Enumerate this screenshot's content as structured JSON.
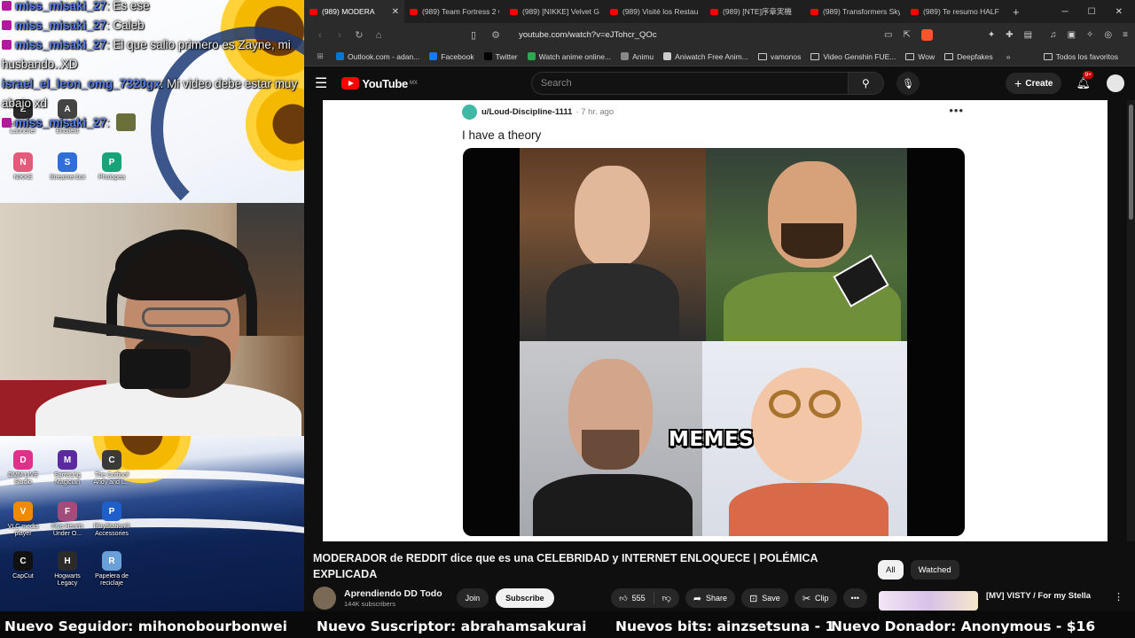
{
  "chat": {
    "lines": [
      {
        "user": "miss_misaki_27",
        "message": "Es ese"
      },
      {
        "user": "miss_misaki_27",
        "message": "Caleb"
      },
      {
        "user": "miss_misaki_27",
        "message": "El que salio primero es Zayne, mi husbando..XD"
      },
      {
        "user": "israel_el_leon_omg_7320gx",
        "message": "Mi video debe estar muy abajo xd"
      },
      {
        "user": "miss_misaki_27",
        "message": ""
      }
    ]
  },
  "desktop_icons": [
    {
      "label": "Epic Games Launcher",
      "color": "#2a2a2a",
      "glyph": "E"
    },
    {
      "label": "Arknights Endfield",
      "color": "#444444",
      "glyph": "A"
    },
    {
      "label": "NIKKE",
      "color": "#e35a7a",
      "glyph": "N"
    },
    {
      "label": "Streamer.bot",
      "color": "#2f6fd6",
      "glyph": "S"
    },
    {
      "label": "Photopea",
      "color": "#18a37a",
      "glyph": "P"
    },
    {
      "label": "DMM LIVE Studio",
      "color": "#e0318a",
      "glyph": "D"
    },
    {
      "label": "Samsung Magician",
      "color": "#5b2aa0",
      "glyph": "M"
    },
    {
      "label": "The Coffinof Andy and L...",
      "color": "#3a3a3a",
      "glyph": "C"
    },
    {
      "label": "VLC media player",
      "color": "#f08a00",
      "glyph": "V"
    },
    {
      "label": "Five Hearts Under O...",
      "color": "#a34b7a",
      "glyph": "F"
    },
    {
      "label": "PlayStation® Accessories",
      "color": "#1f5fc9",
      "glyph": "P"
    },
    {
      "label": "CapCut",
      "color": "#111111",
      "glyph": "C"
    },
    {
      "label": "Hogwarts Legacy",
      "color": "#2b2b2b",
      "glyph": "H"
    },
    {
      "label": "Papelera de reciclaje",
      "color": "#6aa0d8",
      "glyph": "R"
    }
  ],
  "browser": {
    "tabs": [
      {
        "label": "(989) MODERA",
        "active": true
      },
      {
        "label": "(989) Team Fortress 2 C",
        "active": false
      },
      {
        "label": "(989) [NIKKE] Velvet G",
        "active": false
      },
      {
        "label": "(989) Visité los Restau",
        "active": false
      },
      {
        "label": "(989) [NTE]序章実機",
        "active": false
      },
      {
        "label": "(989) Transformers Sky",
        "active": false
      },
      {
        "label": "(989) Te resumo HALF",
        "active": false
      }
    ],
    "url": "youtube.com/watch?v=eJTohcr_QOc",
    "bookmarks": [
      {
        "label": "Outlook.com - adan...",
        "color": "#0078d4",
        "folder": false
      },
      {
        "label": "Facebook",
        "color": "#1877f2",
        "folder": false
      },
      {
        "label": "Twitter",
        "color": "#000000",
        "folder": false
      },
      {
        "label": "Watch anime online...",
        "color": "#2fa84f",
        "folder": false
      },
      {
        "label": "Animu",
        "color": "#888888",
        "folder": false
      },
      {
        "label": "Aniwatch Free Anim...",
        "color": "#cccccc",
        "folder": false
      },
      {
        "label": "vamonos",
        "color": "",
        "folder": true
      },
      {
        "label": "Video Genshin FUE...",
        "color": "",
        "folder": true
      },
      {
        "label": "Wow",
        "color": "",
        "folder": true
      },
      {
        "label": "Deepfakes",
        "color": "",
        "folder": true
      }
    ],
    "bookmarks_all": "Todos los favoritos"
  },
  "youtube": {
    "logo_text": "YouTube",
    "country_code": "MX",
    "search_placeholder": "Search",
    "create_label": "Create",
    "notifications": "9+",
    "video_title": "MODERADOR de REDDIT dice que es una CELEBRIDAD y INTERNET ENLOQUECE | POLÉMICA EXPLICADA",
    "channel_name": "Aprendiendo DD Todo",
    "subscribers": "144K subscribers",
    "join_label": "Join",
    "subscribe_label": "Subscribe",
    "likes": "555",
    "share_label": "Share",
    "save_label": "Save",
    "clip_label": "Clip",
    "chips": [
      "All",
      "Watched"
    ],
    "rec_title": "[MV] VISTY / For my Stella"
  },
  "reddit_post": {
    "user": "u/Loud-Discipline-1111",
    "time": "7 hr. ago",
    "title": "I have a theory",
    "meme_caption": "MEMES"
  },
  "ticker": {
    "items": [
      "Nuevo Seguidor: mihonobourbonwei",
      "Nuevo Suscriptor: abrahamsakurai",
      "Nuevos bits: ainzsetsuna - 1",
      "Nuevo Donador: Anonymous - $16"
    ]
  },
  "colors": {
    "youtube_red": "#ff0000",
    "chat_username": "#5a7fe6",
    "subscribe_bg": "#f1f1f1"
  }
}
